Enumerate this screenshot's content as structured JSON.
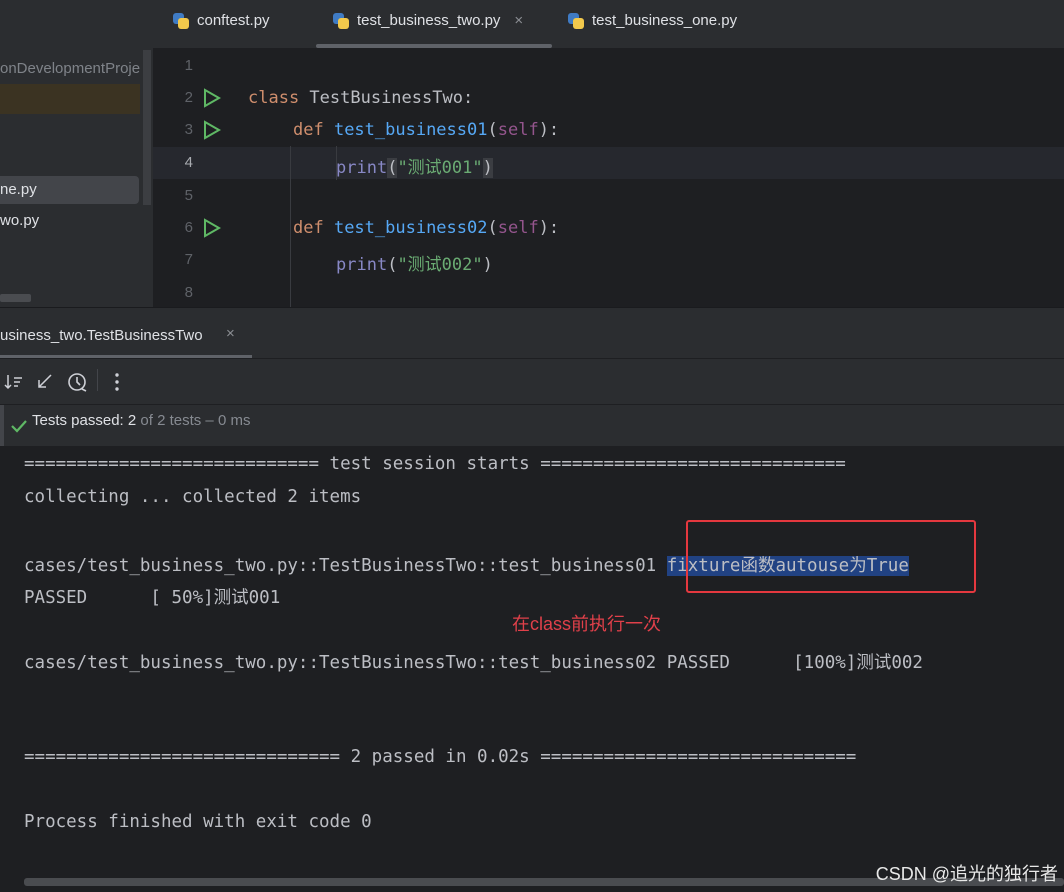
{
  "sidebar": {
    "project_name": "onDevelopmentProje",
    "files": [
      "ne.py",
      "wo.py"
    ]
  },
  "tabs": [
    {
      "label": "conftest.py"
    },
    {
      "label": "test_business_two.py"
    },
    {
      "label": "test_business_one.py"
    }
  ],
  "tab_close_icon": "×",
  "editor": {
    "line_numbers": [
      "1",
      "2",
      "3",
      "4",
      "5",
      "6",
      "7",
      "8"
    ],
    "lines": [
      {
        "kw": "class ",
        "name": "TestBusinessTwo",
        "rest": ":"
      },
      {
        "kw": "def ",
        "name": "test_business01",
        "p1": "(",
        "self": "self",
        "p2": "):"
      },
      {
        "builtin": "print",
        "p1": "(",
        "str": "\"测试001\"",
        "p2": ")"
      },
      {
        "kw": "def ",
        "name": "test_business02",
        "p1": "(",
        "self": "self",
        "p2": "):"
      },
      {
        "builtin": "print",
        "p1": "(",
        "str": "\"测试002\"",
        "p2": ")"
      }
    ]
  },
  "run_panel": {
    "tab_label": "usiness_two.TestBusinessTwo",
    "tab_close": "×",
    "toolbar_icons": [
      "sort-icon",
      "collapse-icon",
      "history-icon",
      "more-icon"
    ],
    "status": {
      "passed_label": "Tests passed: 2",
      "detail": " of 2 tests – 0 ms"
    }
  },
  "console": {
    "session_start": "============================ test session starts =============================",
    "collecting": "collecting ... collected 2 items",
    "test1_path": "cases/test_business_two.py::TestBusinessTwo::test_business01 ",
    "test1_fixture": "fixture函数autouse为True",
    "test1_result": "PASSED      [ 50%]测试001",
    "test2_line": "cases/test_business_two.py::TestBusinessTwo::test_business02 PASSED      [100%]测试002",
    "summary": "============================== 2 passed in 0.02s ==============================",
    "process": "Process finished with exit code 0",
    "annotation": "在class前执行一次"
  },
  "watermark": "CSDN @追光的独行者",
  "colors": {
    "keyword": "#cf8e6d",
    "function": "#56a8f5",
    "string": "#6aab73",
    "annotation_red": "#e5383f",
    "pass_green": "#5fb865"
  }
}
